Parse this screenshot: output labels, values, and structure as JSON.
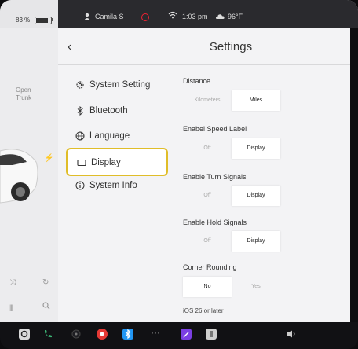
{
  "status_bar": {
    "battery_percent": "83 %",
    "profile_name": "Camila S",
    "time": "1:03 pm",
    "temperature": "96°F"
  },
  "car_panel": {
    "trunk_label": "Open\nTrunk"
  },
  "settings": {
    "title": "Settings",
    "nav": [
      {
        "label": "System Setting",
        "icon": "gear-icon"
      },
      {
        "label": "Bluetooth",
        "icon": "bluetooth-icon"
      },
      {
        "label": "Language",
        "icon": "globe-icon"
      },
      {
        "label": "Display",
        "icon": "display-icon",
        "active": true
      },
      {
        "label": "System Info",
        "icon": "info-icon"
      }
    ],
    "sections": [
      {
        "label": "Distance",
        "options": [
          "Kilometers",
          "Miles"
        ],
        "selected": "Miles"
      },
      {
        "label": "Enabel Speed Label",
        "options": [
          "Off",
          "Display"
        ],
        "selected": "Display"
      },
      {
        "label": "Enable Turn Signals",
        "options": [
          "Off",
          "Display"
        ],
        "selected": "Display"
      },
      {
        "label": "Enable Hold Signals",
        "options": [
          "Off",
          "Display"
        ],
        "selected": "Display"
      },
      {
        "label": "Corner Rounding",
        "options": [
          "No",
          "Yes"
        ],
        "selected": "No"
      }
    ],
    "footnote": "iOS 26 or later"
  },
  "taskbar": {
    "icons": [
      "app-icon",
      "phone-icon",
      "camera-icon",
      "music-icon",
      "bluetooth-icon",
      "more-icon",
      "edit-icon",
      "card-icon",
      "volume-icon"
    ]
  },
  "colors": {
    "highlight": "#e0bd29",
    "panel_bg": "#f3f3f5",
    "taskbar_bg": "#111114",
    "music_red": "#e53935",
    "bluetooth_blue": "#2196f3",
    "edit_purple": "#7b3fe4",
    "phone_green": "#3bb273"
  }
}
